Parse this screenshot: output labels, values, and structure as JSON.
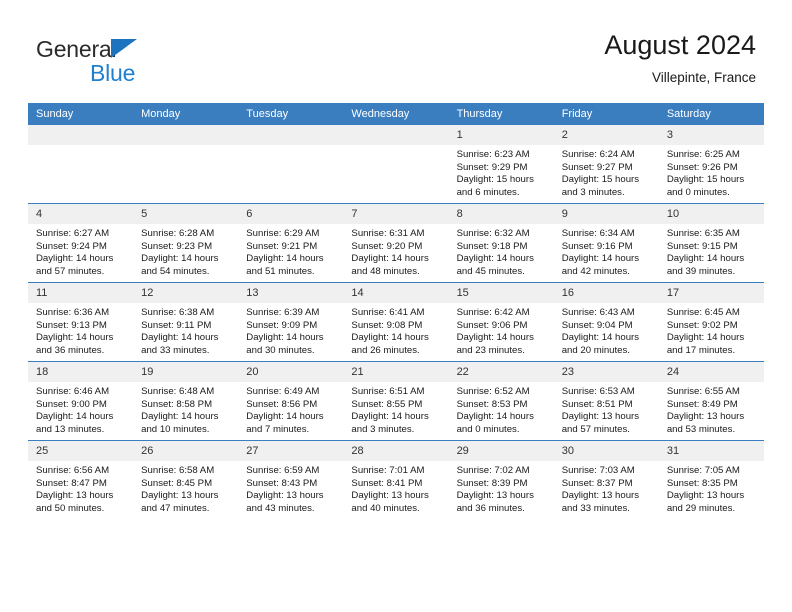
{
  "brand": {
    "name_part1": "General",
    "name_part2": "Blue",
    "triangle_color": "#1e73be",
    "blue_color": "#2080d0"
  },
  "header": {
    "title": "August 2024",
    "location": "Villepinte, France",
    "header_bg_color": "#3b7ec0",
    "daynum_bg_color": "#f0f0f0"
  },
  "weekday_headers": [
    "Sunday",
    "Monday",
    "Tuesday",
    "Wednesday",
    "Thursday",
    "Friday",
    "Saturday"
  ],
  "labels": {
    "sunrise_prefix": "Sunrise:",
    "sunset_prefix": "Sunset:",
    "daylight_prefix": "Daylight:"
  },
  "weeks": [
    [
      {
        "day": "",
        "sunrise": "",
        "sunset": "",
        "daylight_line1": "",
        "daylight_line2": ""
      },
      {
        "day": "",
        "sunrise": "",
        "sunset": "",
        "daylight_line1": "",
        "daylight_line2": ""
      },
      {
        "day": "",
        "sunrise": "",
        "sunset": "",
        "daylight_line1": "",
        "daylight_line2": ""
      },
      {
        "day": "",
        "sunrise": "",
        "sunset": "",
        "daylight_line1": "",
        "daylight_line2": ""
      },
      {
        "day": "1",
        "sunrise": "Sunrise: 6:23 AM",
        "sunset": "Sunset: 9:29 PM",
        "daylight_line1": "Daylight: 15 hours",
        "daylight_line2": "and 6 minutes."
      },
      {
        "day": "2",
        "sunrise": "Sunrise: 6:24 AM",
        "sunset": "Sunset: 9:27 PM",
        "daylight_line1": "Daylight: 15 hours",
        "daylight_line2": "and 3 minutes."
      },
      {
        "day": "3",
        "sunrise": "Sunrise: 6:25 AM",
        "sunset": "Sunset: 9:26 PM",
        "daylight_line1": "Daylight: 15 hours",
        "daylight_line2": "and 0 minutes."
      }
    ],
    [
      {
        "day": "4",
        "sunrise": "Sunrise: 6:27 AM",
        "sunset": "Sunset: 9:24 PM",
        "daylight_line1": "Daylight: 14 hours",
        "daylight_line2": "and 57 minutes."
      },
      {
        "day": "5",
        "sunrise": "Sunrise: 6:28 AM",
        "sunset": "Sunset: 9:23 PM",
        "daylight_line1": "Daylight: 14 hours",
        "daylight_line2": "and 54 minutes."
      },
      {
        "day": "6",
        "sunrise": "Sunrise: 6:29 AM",
        "sunset": "Sunset: 9:21 PM",
        "daylight_line1": "Daylight: 14 hours",
        "daylight_line2": "and 51 minutes."
      },
      {
        "day": "7",
        "sunrise": "Sunrise: 6:31 AM",
        "sunset": "Sunset: 9:20 PM",
        "daylight_line1": "Daylight: 14 hours",
        "daylight_line2": "and 48 minutes."
      },
      {
        "day": "8",
        "sunrise": "Sunrise: 6:32 AM",
        "sunset": "Sunset: 9:18 PM",
        "daylight_line1": "Daylight: 14 hours",
        "daylight_line2": "and 45 minutes."
      },
      {
        "day": "9",
        "sunrise": "Sunrise: 6:34 AM",
        "sunset": "Sunset: 9:16 PM",
        "daylight_line1": "Daylight: 14 hours",
        "daylight_line2": "and 42 minutes."
      },
      {
        "day": "10",
        "sunrise": "Sunrise: 6:35 AM",
        "sunset": "Sunset: 9:15 PM",
        "daylight_line1": "Daylight: 14 hours",
        "daylight_line2": "and 39 minutes."
      }
    ],
    [
      {
        "day": "11",
        "sunrise": "Sunrise: 6:36 AM",
        "sunset": "Sunset: 9:13 PM",
        "daylight_line1": "Daylight: 14 hours",
        "daylight_line2": "and 36 minutes."
      },
      {
        "day": "12",
        "sunrise": "Sunrise: 6:38 AM",
        "sunset": "Sunset: 9:11 PM",
        "daylight_line1": "Daylight: 14 hours",
        "daylight_line2": "and 33 minutes."
      },
      {
        "day": "13",
        "sunrise": "Sunrise: 6:39 AM",
        "sunset": "Sunset: 9:09 PM",
        "daylight_line1": "Daylight: 14 hours",
        "daylight_line2": "and 30 minutes."
      },
      {
        "day": "14",
        "sunrise": "Sunrise: 6:41 AM",
        "sunset": "Sunset: 9:08 PM",
        "daylight_line1": "Daylight: 14 hours",
        "daylight_line2": "and 26 minutes."
      },
      {
        "day": "15",
        "sunrise": "Sunrise: 6:42 AM",
        "sunset": "Sunset: 9:06 PM",
        "daylight_line1": "Daylight: 14 hours",
        "daylight_line2": "and 23 minutes."
      },
      {
        "day": "16",
        "sunrise": "Sunrise: 6:43 AM",
        "sunset": "Sunset: 9:04 PM",
        "daylight_line1": "Daylight: 14 hours",
        "daylight_line2": "and 20 minutes."
      },
      {
        "day": "17",
        "sunrise": "Sunrise: 6:45 AM",
        "sunset": "Sunset: 9:02 PM",
        "daylight_line1": "Daylight: 14 hours",
        "daylight_line2": "and 17 minutes."
      }
    ],
    [
      {
        "day": "18",
        "sunrise": "Sunrise: 6:46 AM",
        "sunset": "Sunset: 9:00 PM",
        "daylight_line1": "Daylight: 14 hours",
        "daylight_line2": "and 13 minutes."
      },
      {
        "day": "19",
        "sunrise": "Sunrise: 6:48 AM",
        "sunset": "Sunset: 8:58 PM",
        "daylight_line1": "Daylight: 14 hours",
        "daylight_line2": "and 10 minutes."
      },
      {
        "day": "20",
        "sunrise": "Sunrise: 6:49 AM",
        "sunset": "Sunset: 8:56 PM",
        "daylight_line1": "Daylight: 14 hours",
        "daylight_line2": "and 7 minutes."
      },
      {
        "day": "21",
        "sunrise": "Sunrise: 6:51 AM",
        "sunset": "Sunset: 8:55 PM",
        "daylight_line1": "Daylight: 14 hours",
        "daylight_line2": "and 3 minutes."
      },
      {
        "day": "22",
        "sunrise": "Sunrise: 6:52 AM",
        "sunset": "Sunset: 8:53 PM",
        "daylight_line1": "Daylight: 14 hours",
        "daylight_line2": "and 0 minutes."
      },
      {
        "day": "23",
        "sunrise": "Sunrise: 6:53 AM",
        "sunset": "Sunset: 8:51 PM",
        "daylight_line1": "Daylight: 13 hours",
        "daylight_line2": "and 57 minutes."
      },
      {
        "day": "24",
        "sunrise": "Sunrise: 6:55 AM",
        "sunset": "Sunset: 8:49 PM",
        "daylight_line1": "Daylight: 13 hours",
        "daylight_line2": "and 53 minutes."
      }
    ],
    [
      {
        "day": "25",
        "sunrise": "Sunrise: 6:56 AM",
        "sunset": "Sunset: 8:47 PM",
        "daylight_line1": "Daylight: 13 hours",
        "daylight_line2": "and 50 minutes."
      },
      {
        "day": "26",
        "sunrise": "Sunrise: 6:58 AM",
        "sunset": "Sunset: 8:45 PM",
        "daylight_line1": "Daylight: 13 hours",
        "daylight_line2": "and 47 minutes."
      },
      {
        "day": "27",
        "sunrise": "Sunrise: 6:59 AM",
        "sunset": "Sunset: 8:43 PM",
        "daylight_line1": "Daylight: 13 hours",
        "daylight_line2": "and 43 minutes."
      },
      {
        "day": "28",
        "sunrise": "Sunrise: 7:01 AM",
        "sunset": "Sunset: 8:41 PM",
        "daylight_line1": "Daylight: 13 hours",
        "daylight_line2": "and 40 minutes."
      },
      {
        "day": "29",
        "sunrise": "Sunrise: 7:02 AM",
        "sunset": "Sunset: 8:39 PM",
        "daylight_line1": "Daylight: 13 hours",
        "daylight_line2": "and 36 minutes."
      },
      {
        "day": "30",
        "sunrise": "Sunrise: 7:03 AM",
        "sunset": "Sunset: 8:37 PM",
        "daylight_line1": "Daylight: 13 hours",
        "daylight_line2": "and 33 minutes."
      },
      {
        "day": "31",
        "sunrise": "Sunrise: 7:05 AM",
        "sunset": "Sunset: 8:35 PM",
        "daylight_line1": "Daylight: 13 hours",
        "daylight_line2": "and 29 minutes."
      }
    ]
  ]
}
